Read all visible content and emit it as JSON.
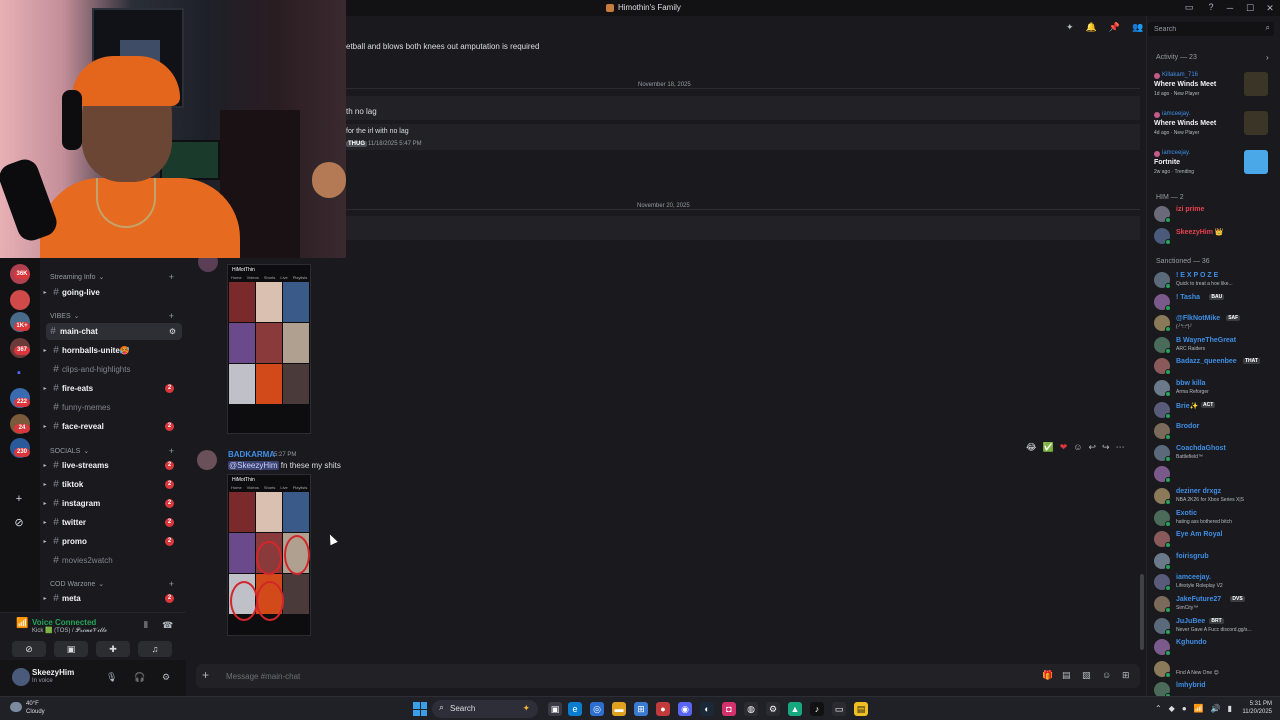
{
  "window": {
    "title": "Himothin's Family"
  },
  "chat": {
    "fragments": {
      "line1": "etball and blows both knees out amputation is required",
      "line2": "th no lag",
      "line3": "for the irl with no lag",
      "tag": "THUG",
      "time3": "11/18/2025 5:47 PM"
    },
    "dividers": [
      "November 18, 2025",
      "November 20, 2025"
    ],
    "message": {
      "author": "BADKARMA",
      "time": "5:27 PM",
      "mention": "@SkeezyHim",
      "text": " fn these my shits"
    },
    "screenshot": {
      "header": "HiMotThin",
      "tabs": [
        "Home",
        "Videos",
        "Shorts",
        "Live",
        "Playlists"
      ]
    },
    "composer_placeholder": "Message #main-chat"
  },
  "sidebar": {
    "categories": {
      "streaming": "Streaming Info",
      "vibes": "VIBES",
      "socials": "SOCIALS",
      "cod": "COD Warzone"
    },
    "channels": [
      {
        "name": "going-live",
        "badge": ""
      },
      {
        "name": "main-chat",
        "badge": ""
      },
      {
        "name": "hornballs-unite🥵",
        "badge": ""
      },
      {
        "name": "clips-and-highlights",
        "badge": ""
      },
      {
        "name": "fire-eats",
        "badge": "2"
      },
      {
        "name": "funny-memes",
        "badge": ""
      },
      {
        "name": "face-reveal",
        "badge": "2"
      },
      {
        "name": "live-streams",
        "badge": "2"
      },
      {
        "name": "tiktok",
        "badge": "2"
      },
      {
        "name": "instagram",
        "badge": "2"
      },
      {
        "name": "twitter",
        "badge": "2"
      },
      {
        "name": "promo",
        "badge": "2"
      },
      {
        "name": "movies2watch",
        "badge": ""
      },
      {
        "name": "meta",
        "badge": "2"
      }
    ]
  },
  "servers": {
    "badges": [
      "36K",
      "1K+",
      "367",
      "222",
      "24",
      "230"
    ]
  },
  "voice": {
    "title": "Voice Connected",
    "subtitle": "Kick 🟩 (TOS) / 𝓟𝓻𝓲𝓶𝓮𝓥𝓲𝓵𝓵𝓮"
  },
  "user": {
    "name": "SkeezyHim",
    "status": "In voice"
  },
  "right": {
    "search_placeholder": "Search",
    "activity_title": "Activity — 23",
    "activities": [
      {
        "user": "Killakam_716",
        "game": "Where Winds Meet",
        "meta": "1d ago · New Player"
      },
      {
        "user": "iamceejay.",
        "game": "Where Winds Meet",
        "meta": "4d ago · New Player"
      },
      {
        "user": "iamceejay.",
        "game": "Fortnite",
        "meta": "2w ago · Trending"
      }
    ],
    "him_title": "HIM — 2",
    "him_members": [
      {
        "name": "izi prime",
        "color": "#e8424f"
      },
      {
        "name": "SkeezyHim 👑",
        "color": "#e8424f"
      }
    ],
    "sanctioned_title": "Sanctioned — 36",
    "members": [
      {
        "name": "! E X P O Z E",
        "sub": "Quick to treat a hoe like...",
        "tag": ""
      },
      {
        "name": "! Tasha",
        "sub": "",
        "tag": "BAU"
      },
      {
        "name": "@FlkNotMike",
        "sub": "(╯°□°)╯",
        "tag": "SAF"
      },
      {
        "name": "B WayneTheGreat",
        "sub": "ARC Raiders",
        "tag": ""
      },
      {
        "name": "Badazz_queenbee",
        "sub": "",
        "tag": "THAT"
      },
      {
        "name": "bbw killa",
        "sub": "Arma Reforger",
        "tag": ""
      },
      {
        "name": "Brie✨",
        "sub": "",
        "tag": "ACT"
      },
      {
        "name": "Brodor",
        "sub": "",
        "tag": ""
      },
      {
        "name": "CoachdaGhost",
        "sub": "Battlefield™",
        "tag": ""
      },
      {
        "name": "",
        "sub": "",
        "tag": ""
      },
      {
        "name": "deziner drxgz",
        "sub": "NBA 2K26 for Xbox Series X|S",
        "tag": ""
      },
      {
        "name": "Exotic",
        "sub": "hating ass bothered bitch",
        "tag": ""
      },
      {
        "name": "Eye Am Royal",
        "sub": "",
        "tag": ""
      },
      {
        "name": "foirisgrub",
        "sub": "",
        "tag": ""
      },
      {
        "name": "iamceejay.",
        "sub": "Lifestyle Roleplay V2",
        "tag": ""
      },
      {
        "name": "JakeFuture27",
        "sub": "SimCity™",
        "tag": "DVS"
      },
      {
        "name": "JuJuBee",
        "sub": "Never Gave A Fucc discord.gg/s...",
        "tag": "BRT"
      },
      {
        "name": "Kghundo",
        "sub": "",
        "tag": ""
      },
      {
        "name": "",
        "sub": "Find A New One 😌",
        "tag": ""
      },
      {
        "name": "lmhybrid",
        "sub": "",
        "tag": ""
      }
    ]
  },
  "taskbar": {
    "weather_temp": "40°F",
    "weather_desc": "Cloudy",
    "search": "Search",
    "time": "5:31 PM",
    "date": "11/20/2025"
  },
  "colors": {
    "accent_blue": "#3f8ee6",
    "online_green": "#23a55a",
    "badge_red": "#da373c",
    "webcam_orange": "#e66a1f"
  }
}
